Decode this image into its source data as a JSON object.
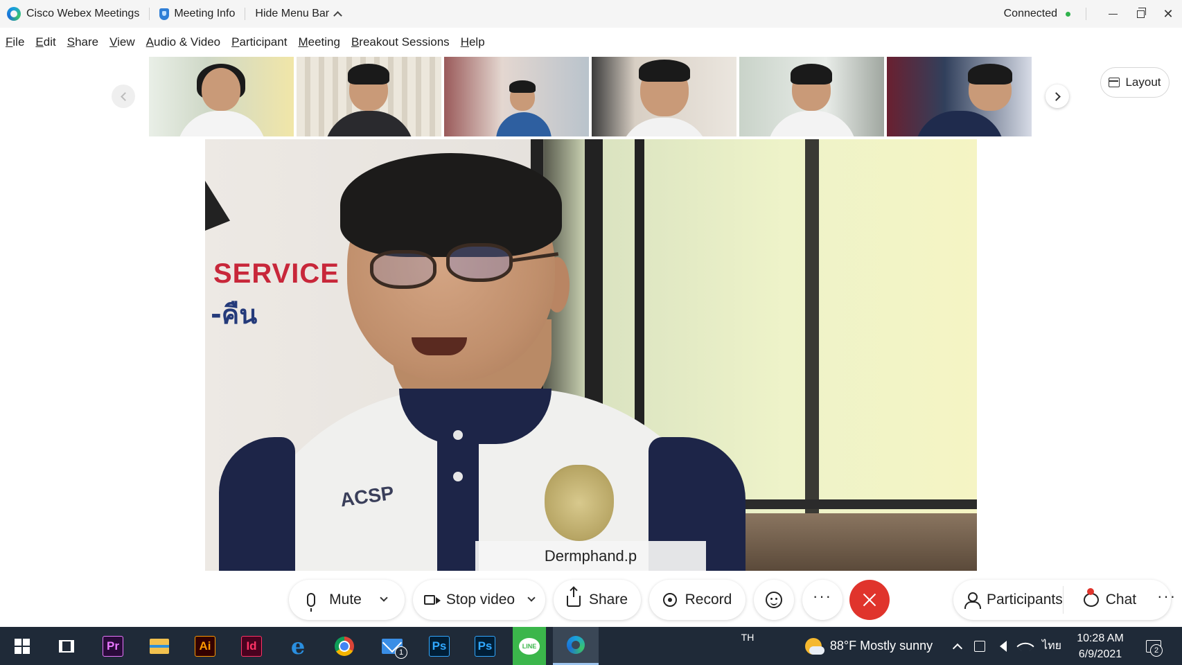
{
  "titlebar": {
    "app_name": "Cisco Webex Meetings",
    "meeting_info": "Meeting Info",
    "hide_menu_bar": "Hide Menu Bar",
    "status": "Connected",
    "status_color": "#2fb24c"
  },
  "menu": [
    "File",
    "Edit",
    "Share",
    "View",
    "Audio & Video",
    "Participant",
    "Meeting",
    "Breakout Sessions",
    "Help"
  ],
  "layout_button": "Layout",
  "main_video": {
    "speaker_name": "Dermphand.p",
    "sign_line1": "SERVICE",
    "sign_line2": "-คืน",
    "shirt_text": "ACSP"
  },
  "controls": {
    "mute": "Mute",
    "stop_video": "Stop video",
    "share": "Share",
    "record": "Record",
    "participants": "Participants",
    "chat": "Chat",
    "more": "···",
    "end_color": "#e0342c"
  },
  "taskbar": {
    "apps": [
      {
        "name": "premiere",
        "label": "Pr",
        "fg": "#ea77ff",
        "bg": "#2a0a3a"
      },
      {
        "name": "illustrator",
        "label": "Ai",
        "fg": "#300",
        "bg": "#ff9a00"
      },
      {
        "name": "indesign",
        "label": "Id",
        "fg": "#ff3366",
        "bg": "#49021f"
      },
      {
        "name": "photoshop-1",
        "label": "Ps"
      },
      {
        "name": "photoshop-2",
        "label": "Ps"
      }
    ],
    "mail_badge": "1",
    "line_label": "LINE",
    "input_lang": "TH",
    "weather": "88°F  Mostly sunny",
    "ime": "ไทย",
    "time": "10:28 AM",
    "date": "6/9/2021",
    "notification_count": "2"
  }
}
